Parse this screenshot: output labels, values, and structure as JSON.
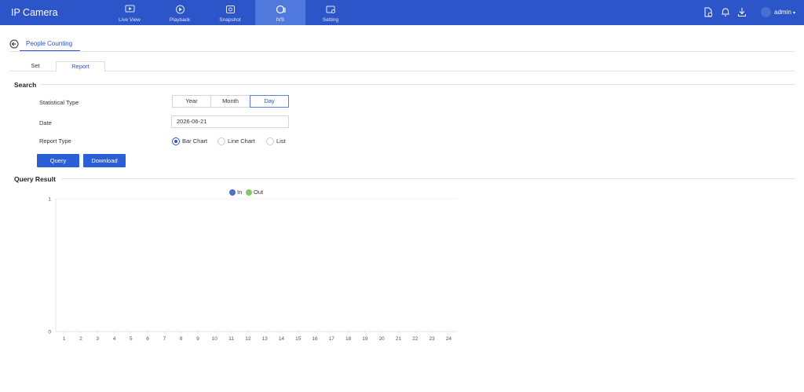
{
  "app": {
    "title": "IP Camera"
  },
  "nav": [
    {
      "label": "Live View",
      "icon": "live-view-icon",
      "active": false
    },
    {
      "label": "Playback",
      "icon": "playback-icon",
      "active": false
    },
    {
      "label": "Snapshot",
      "icon": "snapshot-icon",
      "active": false
    },
    {
      "label": "IVS",
      "icon": "ivs-icon",
      "active": true
    },
    {
      "label": "Setting",
      "icon": "setting-icon",
      "active": false
    }
  ],
  "header_icons": [
    "log-file-icon",
    "bell-icon",
    "download-icon"
  ],
  "user": {
    "name": "admin",
    "caret": "▾"
  },
  "page": {
    "tab": "People Counting",
    "subtabs": [
      "Set",
      "Report"
    ],
    "active_subtab": "Report"
  },
  "search": {
    "title": "Search",
    "statistical_type": {
      "label": "Statistical Type",
      "options": [
        "Year",
        "Month",
        "Day"
      ],
      "selected": "Day"
    },
    "date": {
      "label": "Date",
      "value": "2026-06-21"
    },
    "report_type": {
      "label": "Report Type",
      "options": [
        "Bar Chart",
        "Line Chart",
        "List"
      ],
      "selected": "Bar Chart"
    },
    "query_label": "Query",
    "download_label": "Download"
  },
  "result": {
    "title": "Query Result"
  },
  "colors": {
    "accent": "#2b55c8",
    "in": "#4a6fd3",
    "out": "#7cc66b"
  },
  "chart_data": {
    "type": "bar",
    "categories": [
      "1",
      "2",
      "3",
      "4",
      "5",
      "6",
      "7",
      "8",
      "9",
      "10",
      "11",
      "12",
      "13",
      "14",
      "15",
      "16",
      "17",
      "18",
      "19",
      "20",
      "21",
      "22",
      "23",
      "24"
    ],
    "series": [
      {
        "name": "In",
        "values": [
          0,
          0,
          0,
          0,
          0,
          0,
          0,
          0,
          0,
          0,
          0,
          0,
          0,
          0,
          0,
          0,
          0,
          0,
          0,
          0,
          0,
          0,
          0,
          0
        ]
      },
      {
        "name": "Out",
        "values": [
          0,
          0,
          0,
          0,
          0,
          0,
          0,
          0,
          0,
          0,
          0,
          0,
          0,
          0,
          0,
          0,
          0,
          0,
          0,
          0,
          0,
          0,
          0,
          0
        ]
      }
    ],
    "ylim": [
      0,
      1
    ],
    "yticks": [
      "0",
      "1"
    ],
    "legend": "top-center",
    "grid": false
  }
}
